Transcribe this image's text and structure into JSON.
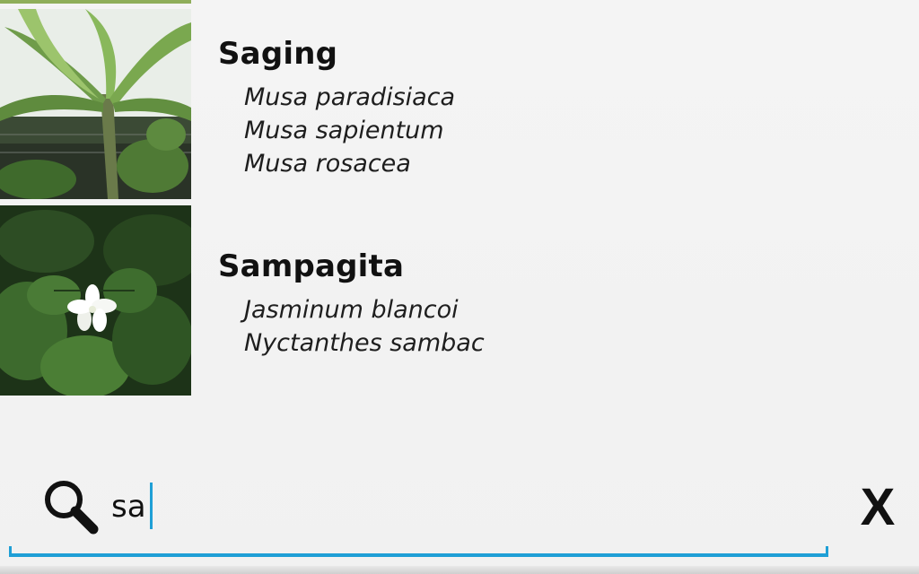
{
  "results": [
    {
      "name": "Saging",
      "image": "banana-plant",
      "scientific_names": [
        "Musa paradisiaca",
        "Musa sapientum",
        "Musa rosacea"
      ]
    },
    {
      "name": "Sampagita",
      "image": "jasmine-flower",
      "scientific_names": [
        "Jasminum blancoi",
        "Nyctanthes sambac"
      ]
    }
  ],
  "search": {
    "value": "sa",
    "icon": "search-icon",
    "clear_label": "X"
  },
  "colors": {
    "accent": "#1f9fd6",
    "background": "#f4f4f4",
    "text": "#111111"
  }
}
